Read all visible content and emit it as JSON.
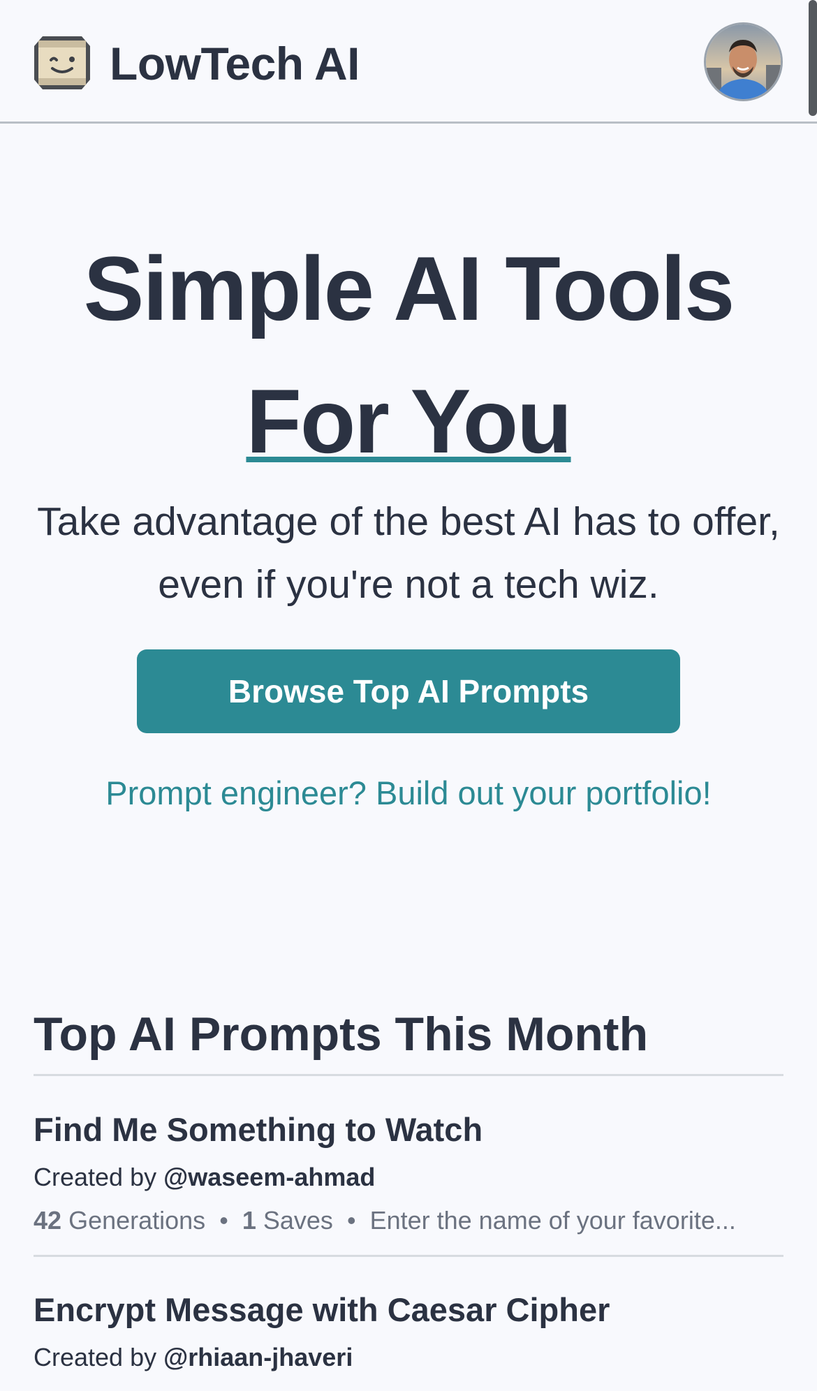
{
  "header": {
    "brand": "LowTech AI",
    "logo_icon": "smiley-robot-icon",
    "avatar": "user-avatar"
  },
  "hero": {
    "title_line1": "Simple AI Tools",
    "title_line2": "For You",
    "subtitle": "Take advantage of the best AI has to offer, even if you're not a tech wiz.",
    "cta_label": "Browse Top AI Prompts",
    "portfolio_link": "Prompt engineer? Build out your portfolio!"
  },
  "section": {
    "title": "Top AI Prompts This Month"
  },
  "prompts": [
    {
      "title": "Find Me Something to Watch",
      "created_by_label": "Created by",
      "handle": "@waseem-ahmad",
      "generations_count": "42",
      "generations_label": "Generations",
      "saves_count": "1",
      "saves_label": "Saves",
      "description": "Enter the name of your favorite..."
    },
    {
      "title": "Encrypt Message with Caesar Cipher",
      "created_by_label": "Created by",
      "handle": "@rhiaan-jhaveri"
    }
  ],
  "colors": {
    "accent": "#2c8a94",
    "text": "#2b3242",
    "muted": "#6b7280",
    "background": "#f8f9fd"
  }
}
